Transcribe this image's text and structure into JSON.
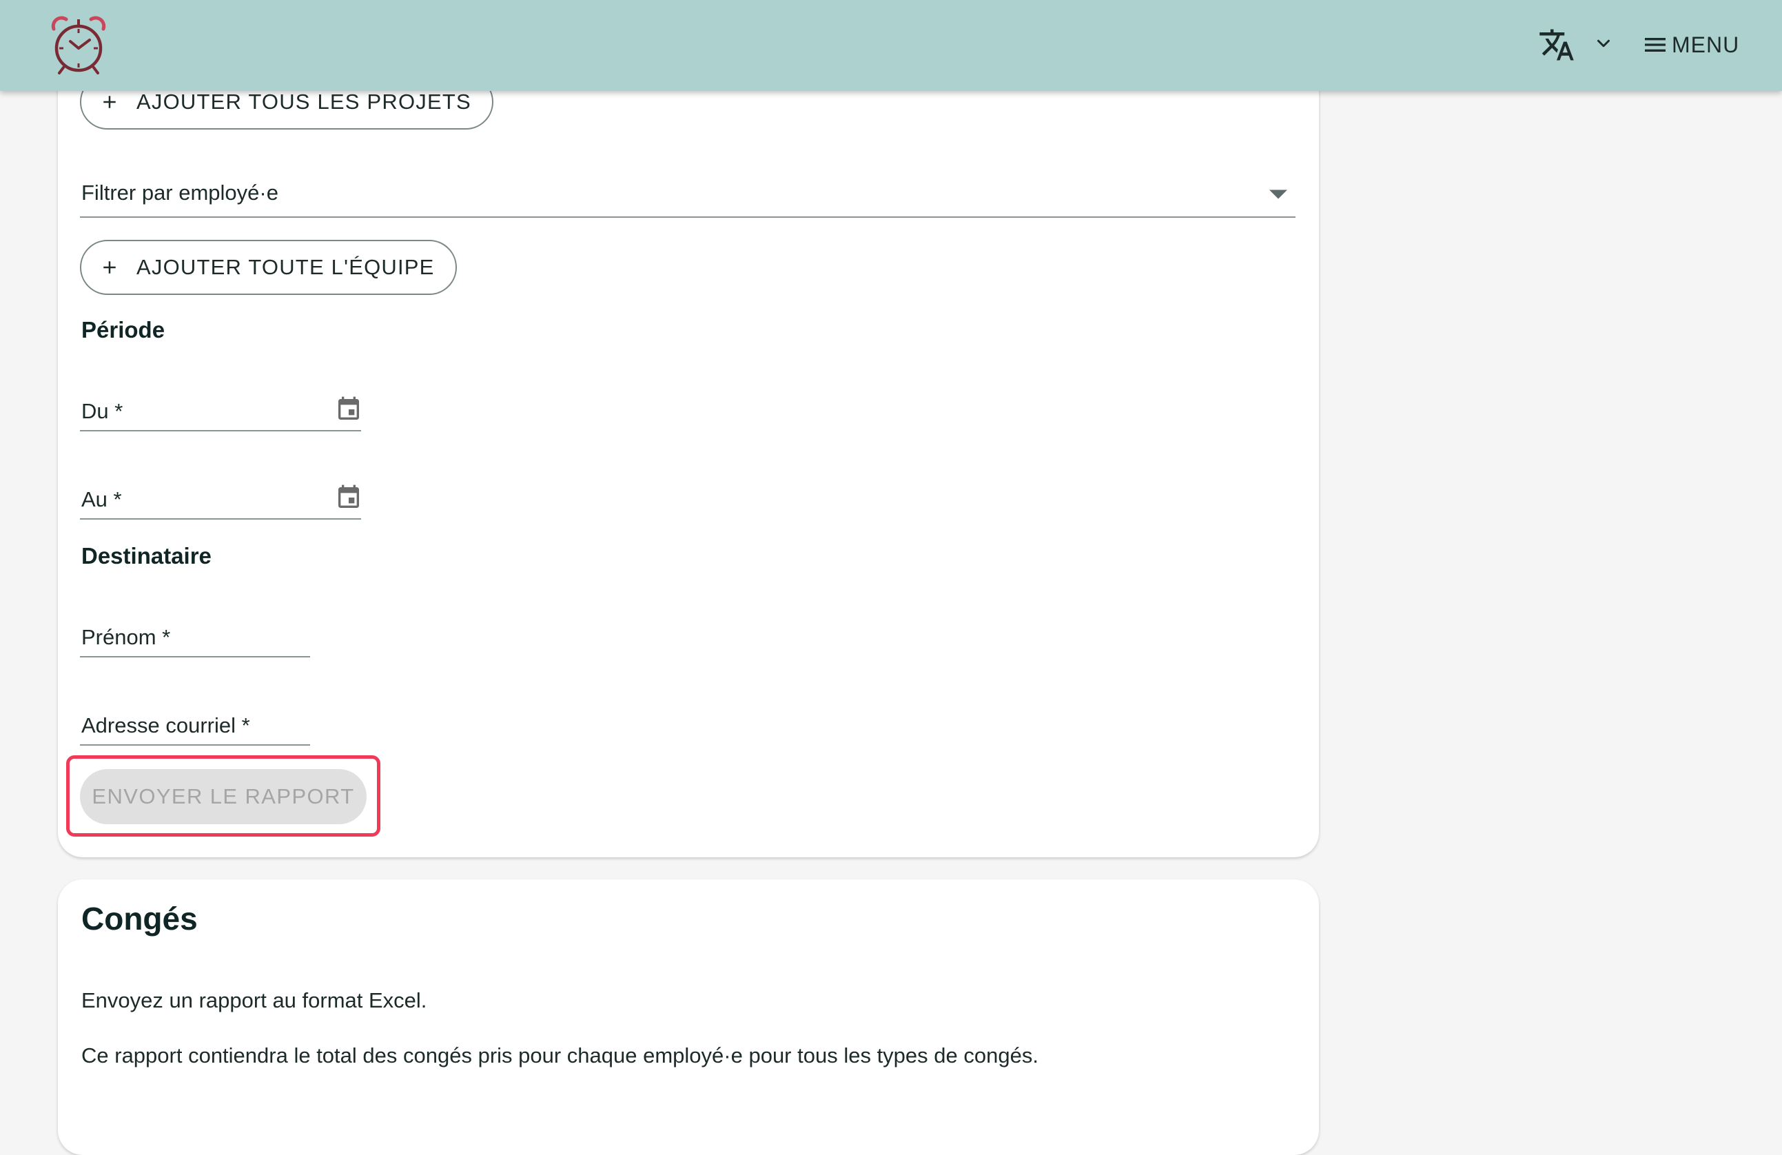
{
  "header": {
    "logo_icon": "alarm-clock-icon",
    "language_icon": "translate-icon",
    "menu_label": "MENU",
    "bar_color": "#acd1cf"
  },
  "report_card": {
    "add_all_projects_label": "AJOUTER TOUS LES PROJETS",
    "employee_filter_label": "Filtrer par employé·e",
    "add_whole_team_label": "AJOUTER TOUTE L'ÉQUIPE",
    "period_heading": "Période",
    "from_label": "Du *",
    "to_label": "Au *",
    "recipient_heading": "Destinataire",
    "first_name_label": "Prénom *",
    "email_label": "Adresse courriel *",
    "send_button_label": "ENVOYER LE RAPPORT"
  },
  "leave_card": {
    "title": "Congés",
    "description_1": "Envoyez un rapport au format Excel.",
    "description_2": "Ce rapport contiendra le total des congés pris pour chaque employé·e pour tous les types de congés."
  },
  "colors": {
    "highlight": "#ef3b57",
    "disabled_button_bg": "#e0e0e0",
    "disabled_button_text": "#a5a5a5"
  }
}
